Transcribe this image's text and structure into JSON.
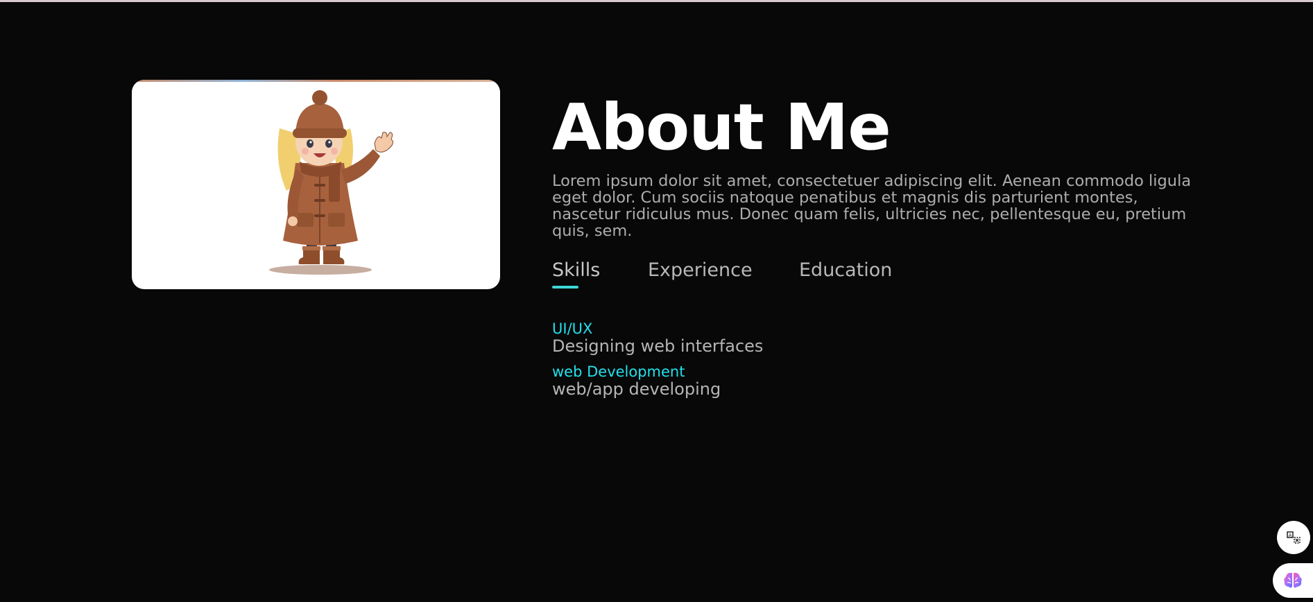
{
  "about": {
    "title": "About Me",
    "intro": "Lorem ipsum dolor sit amet, consectetuer adipiscing elit. Aenean commodo ligula eget dolor. Cum sociis natoque penatibus et magnis dis parturient montes, nascetur ridiculus mus. Donec quam felis, ultricies nec, pellentesque eu, pretium quis, sem."
  },
  "tabs": [
    {
      "label": "Skills",
      "active": true
    },
    {
      "label": "Experience",
      "active": false
    },
    {
      "label": "Education",
      "active": false
    }
  ],
  "skills": [
    {
      "name": "UI/UX",
      "desc": "Designing web interfaces"
    },
    {
      "name": "web Development",
      "desc": "web/app developing"
    }
  ],
  "colors": {
    "background": "#080808",
    "accent": "#22e0ec",
    "tab_underline": "#3dd7d7",
    "text_muted": "#adadad"
  },
  "icons": {
    "translate": "translate-icon",
    "brain": "brain-icon"
  }
}
